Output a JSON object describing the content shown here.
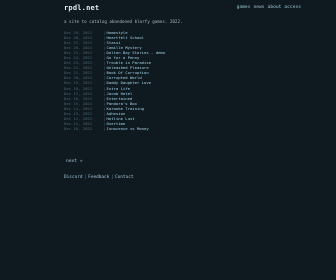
{
  "site": {
    "logo": "rpdl.net"
  },
  "topnav": {
    "games": "games",
    "news": "news",
    "about": "about",
    "access": "access"
  },
  "tagline": "a site to catalog abandoned blorfy games. 2022.",
  "separator": "|",
  "games": [
    {
      "date": "Dec 29, 2021",
      "title": "Homestyle"
    },
    {
      "date": "Dec 28, 2021",
      "title": "Heartfelt School"
    },
    {
      "date": "Dec 27, 2021",
      "title": "Stassi"
    },
    {
      "date": "Dec 26, 2021",
      "title": "Camille Mystery"
    },
    {
      "date": "Dec 25, 2021",
      "title": "Dalton Bay Stories - demo"
    },
    {
      "date": "Dec 24, 2021",
      "title": "Go for a Penny"
    },
    {
      "date": "Dec 23, 2021",
      "title": "Trouble in Paradise"
    },
    {
      "date": "Dec 22, 2021",
      "title": "Unleashed Pleasure"
    },
    {
      "date": "Dec 21, 2021",
      "title": "Book Of Corruption"
    },
    {
      "date": "Dec 20, 2021",
      "title": "Corrupted World"
    },
    {
      "date": "Dec 19, 2021",
      "title": "Daddy Daughter Love"
    },
    {
      "date": "Dec 18, 2021",
      "title": "Extra Life"
    },
    {
      "date": "Dec 17, 2021",
      "title": "Jacob Hotel"
    },
    {
      "date": "Dec 16, 2021",
      "title": "Entertained"
    },
    {
      "date": "Dec 15, 2021",
      "title": "Pandora's Box"
    },
    {
      "date": "Dec 14, 2021",
      "title": "Karaoke Training"
    },
    {
      "date": "Dec 13, 2021",
      "title": "Adhesion"
    },
    {
      "date": "Dec 12, 2021",
      "title": "Hotline Lust"
    },
    {
      "date": "Dec 11, 2021",
      "title": "Overtime"
    },
    {
      "date": "Dec 10, 2021",
      "title": "Innocence vs Money"
    }
  ],
  "pagination": {
    "next": "next »"
  },
  "footer": {
    "discord": "Discord",
    "feedback": "Feedback",
    "contact": "Contact"
  }
}
